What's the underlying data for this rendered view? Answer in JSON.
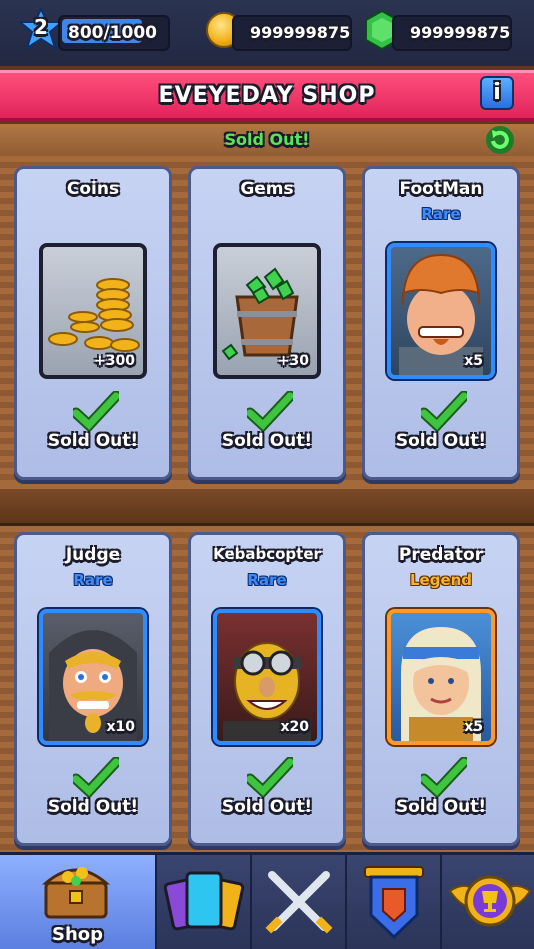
{
  "header": {
    "level": "2",
    "xp_text": "800/1000",
    "xp_progress": 0.8,
    "coins": "999999875",
    "gems": "999999875"
  },
  "banner": {
    "title": "EVEYEDAY SHOP",
    "info_label": "i"
  },
  "status": {
    "sold_out_text": "Sold Out!"
  },
  "cards": [
    {
      "name": "Coins",
      "rarity": "",
      "quantity": "+300",
      "status": "Sold Out!",
      "icon": "coins-pile-icon"
    },
    {
      "name": "Gems",
      "rarity": "",
      "quantity": "+30",
      "status": "Sold Out!",
      "icon": "gem-bucket-icon"
    },
    {
      "name": "FootMan",
      "rarity": "Rare",
      "quantity": "x5",
      "status": "Sold Out!",
      "icon": "footman-portrait"
    },
    {
      "name": "Judge",
      "rarity": "Rare",
      "quantity": "x10",
      "status": "Sold Out!",
      "icon": "judge-portrait"
    },
    {
      "name": "Kebabcopter",
      "rarity": "Rare",
      "quantity": "x20",
      "status": "Sold Out!",
      "icon": "kebabcopter-portrait"
    },
    {
      "name": "Predator",
      "rarity": "Legend",
      "quantity": "x5",
      "status": "Sold Out!",
      "icon": "predator-portrait"
    }
  ],
  "nav": {
    "tabs": [
      {
        "label": "Shop",
        "icon": "treasure-chest-icon",
        "active": true
      },
      {
        "label": "",
        "icon": "cards-icon"
      },
      {
        "label": "",
        "icon": "crossed-swords-icon"
      },
      {
        "label": "",
        "icon": "clan-shield-icon"
      },
      {
        "label": "",
        "icon": "trophy-icon"
      }
    ]
  },
  "colors": {
    "banner": "#e0245b",
    "rare": "#3a8cff",
    "legend": "#ffb02e",
    "check": "#3ec43e"
  }
}
